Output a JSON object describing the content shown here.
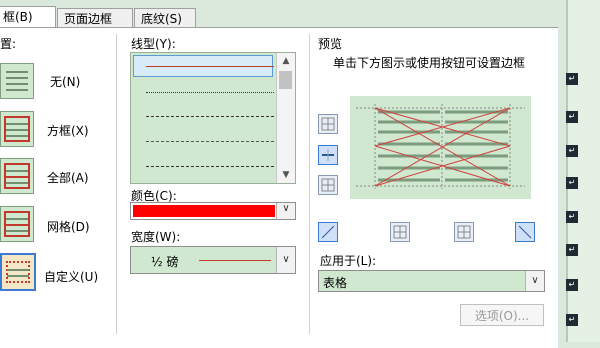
{
  "tabs": [
    {
      "label": "框(B)"
    },
    {
      "label": "页面边框(P)"
    },
    {
      "label": "底纹(S)"
    }
  ],
  "setting": {
    "title": "置:",
    "options": [
      {
        "label": "无(N)"
      },
      {
        "label": "方框(X)"
      },
      {
        "label": "全部(A)"
      },
      {
        "label": "网格(D)"
      },
      {
        "label": "自定义(U)"
      }
    ]
  },
  "style": {
    "label": "线型(Y):",
    "color_label": "颜色(C):",
    "color_value": "#ff0000",
    "width_label": "宽度(W):",
    "width_value": "½ 磅"
  },
  "preview": {
    "title": "预览",
    "hint": "单击下方图示或使用按钮可设置边框",
    "apply_label": "应用于(L):",
    "apply_value": "表格",
    "options_button": "选项(O)..."
  },
  "icons": {
    "scroll_up": "▲",
    "scroll_down": "▼",
    "dropdown": "∨",
    "para_mark": "↵"
  },
  "colors": {
    "accent": "#3a7bd5",
    "border_red": "#c0392b",
    "thumb_green": "#cfe8cf"
  }
}
